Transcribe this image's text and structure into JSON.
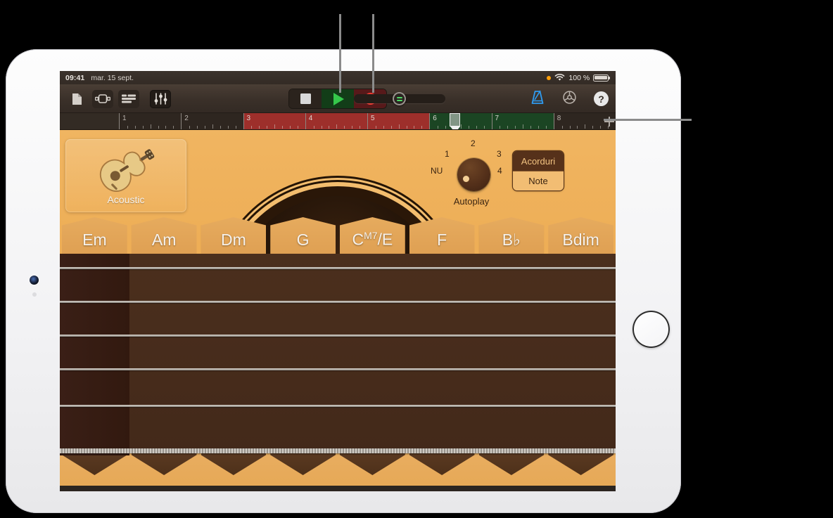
{
  "status_bar": {
    "time": "09:41",
    "date": "mar. 15 sept.",
    "battery_percent": "100 %",
    "orange_dot": "recording-indicator-dot",
    "wifi": "wifi-icon",
    "battery": "battery-icon"
  },
  "toolbar": {
    "left_icons": [
      {
        "name": "my-songs-icon",
        "label": "Piesele mele"
      },
      {
        "name": "track-view-icon",
        "label": "Vizualizare instrument"
      },
      {
        "name": "tracks-icon",
        "label": "Vizualizare piese"
      },
      {
        "name": "mixer-icon",
        "label": "Comenzi piesă"
      }
    ],
    "transport": {
      "stop_label": "Stop",
      "play_label": "Redare",
      "record_label": "Înregistrare"
    },
    "slider_label": "Volum master",
    "metronome_label": "Metronom",
    "settings_label": "Reglaje",
    "help_label": "?"
  },
  "ruler": {
    "bars": [
      {
        "number": "1",
        "state": "dark"
      },
      {
        "number": "2",
        "state": "dark"
      },
      {
        "number": "3",
        "state": "red"
      },
      {
        "number": "4",
        "state": "red"
      },
      {
        "number": "5",
        "state": "red"
      },
      {
        "number": "6",
        "state": "green"
      },
      {
        "number": "7",
        "state": "green"
      },
      {
        "number": "8",
        "state": "dark"
      }
    ],
    "playhead_bar": "5.5",
    "add_button": "+"
  },
  "instrument": {
    "label": "Acoustic",
    "icon": "acoustic-guitar-icon"
  },
  "autoplay": {
    "title": "Autoplay",
    "positions": [
      "NU",
      "1",
      "2",
      "3",
      "4"
    ],
    "selected": "NU"
  },
  "mode_switch": {
    "chords_label": "Acorduri",
    "notes_label": "Note",
    "selected": "Acorduri"
  },
  "chords": [
    {
      "root": "Em",
      "sup": ""
    },
    {
      "root": "Am",
      "sup": ""
    },
    {
      "root": "Dm",
      "sup": ""
    },
    {
      "root": "G",
      "sup": ""
    },
    {
      "root": "C",
      "sup": "M7",
      "suffix": "/E"
    },
    {
      "root": "F",
      "sup": ""
    },
    {
      "root": "B",
      "sup": "",
      "suffix": "♭"
    },
    {
      "root": "Bdim",
      "sup": ""
    }
  ],
  "colors": {
    "play_green": "#35c84b",
    "record_red": "#f23b31",
    "cycle_red": "#9d2f2b",
    "region_green": "#1b4523",
    "wood_light": "#edab52",
    "wood_dark": "#43291a",
    "accent_blue": "#2f9bf0"
  }
}
